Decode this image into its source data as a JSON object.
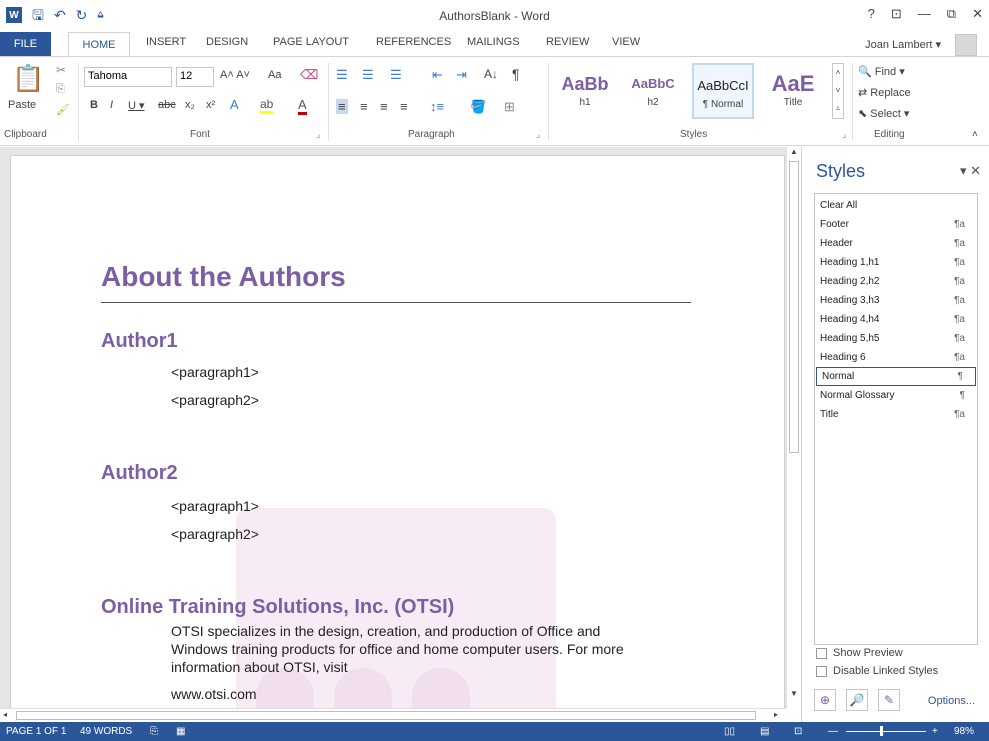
{
  "window": {
    "title": "AuthorsBlank - Word",
    "controls": [
      "?",
      "⊡",
      "—",
      "⧉",
      "✕"
    ]
  },
  "qat": {
    "logo": "W",
    "save_icon": "save-icon",
    "undo_icon": "undo-icon",
    "redo_icon": "redo-icon"
  },
  "tabs": {
    "file": "FILE",
    "home": "HOME",
    "insert": "INSERT",
    "design": "DESIGN",
    "page_layout": "PAGE LAYOUT",
    "references": "REFERENCES",
    "mailings": "MAILINGS",
    "review": "REVIEW",
    "view": "VIEW"
  },
  "user": {
    "name": "Joan Lambert ▾"
  },
  "ribbon": {
    "clipboard": {
      "label": "Clipboard",
      "paste": "Paste"
    },
    "font": {
      "label": "Font",
      "name": "Tahoma",
      "size": "12",
      "aa": "Aa"
    },
    "paragraph": {
      "label": "Paragraph"
    },
    "styles": {
      "label": "Styles",
      "tiles": [
        {
          "sample": "AaBb",
          "name": "h1"
        },
        {
          "sample": "AaBbC",
          "name": "h2"
        },
        {
          "sample": "AaBbCcI",
          "name": "¶ Normal"
        },
        {
          "sample": "AaE",
          "name": "Title"
        }
      ]
    },
    "editing": {
      "label": "Editing",
      "find": "Find",
      "replace": "Replace",
      "select": "Select"
    }
  },
  "document": {
    "heading1": "About the Authors",
    "author1": "Author1",
    "author1_p1": "<paragraph1>",
    "author1_p2": "<paragraph2>",
    "author2": "Author2",
    "author2_p1": "<paragraph1>",
    "author2_p2": "<paragraph2>",
    "otsi_heading": "Online Training Solutions, Inc. (OTSI)",
    "otsi_body": "OTSI specializes in the design, creation, and production of Office and Windows training products for office and home computer users. For more information about OTSI, visit",
    "otsi_url": "www.otsi.com"
  },
  "styles_pane": {
    "title": "Styles",
    "items": [
      {
        "name": "Clear All",
        "mark": ""
      },
      {
        "name": "Footer",
        "mark": "¶a"
      },
      {
        "name": "Header",
        "mark": "¶a"
      },
      {
        "name": "Heading 1,h1",
        "mark": "¶a"
      },
      {
        "name": "Heading 2,h2",
        "mark": "¶a"
      },
      {
        "name": "Heading 3,h3",
        "mark": "¶a"
      },
      {
        "name": "Heading 4,h4",
        "mark": "¶a"
      },
      {
        "name": "Heading 5,h5",
        "mark": "¶a"
      },
      {
        "name": "Heading 6",
        "mark": "¶a"
      },
      {
        "name": "Normal",
        "mark": "¶"
      },
      {
        "name": "Normal Glossary",
        "mark": "¶"
      },
      {
        "name": "Title",
        "mark": "¶a"
      }
    ],
    "show_preview": "Show Preview",
    "disable_linked": "Disable Linked Styles",
    "options": "Options..."
  },
  "status": {
    "page": "PAGE 1 OF 1",
    "words": "49 WORDS",
    "zoom": "98%"
  },
  "colors": {
    "accent": "#2b579a",
    "heading": "#7c5ea4"
  }
}
